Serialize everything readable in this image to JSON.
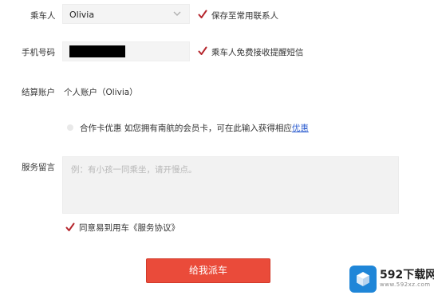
{
  "passenger": {
    "label": "乘车人",
    "selected": "Olivia",
    "save_label": "保存至常用联系人"
  },
  "phone": {
    "label": "手机号码",
    "sms_label": "乘车人免费接收提醒短信"
  },
  "account": {
    "label": "结算账户",
    "value": "个人账户（Olivia）"
  },
  "coop": {
    "text": "合作卡优惠 如您拥有南航的会员卡，可在此输入获得相应",
    "link": "优惠"
  },
  "message": {
    "label": "服务留言",
    "placeholder": "例：有小孩一同乘坐，请开慢点。"
  },
  "agreement": {
    "text": "同意易到用车《服务协议》"
  },
  "submit_label": "给我派车",
  "watermark": {
    "brand": "592下载网",
    "url": "www.592xz.com"
  },
  "colors": {
    "accent": "#ea4b3a",
    "check": "#b5262d",
    "link": "#2f5fd0"
  }
}
